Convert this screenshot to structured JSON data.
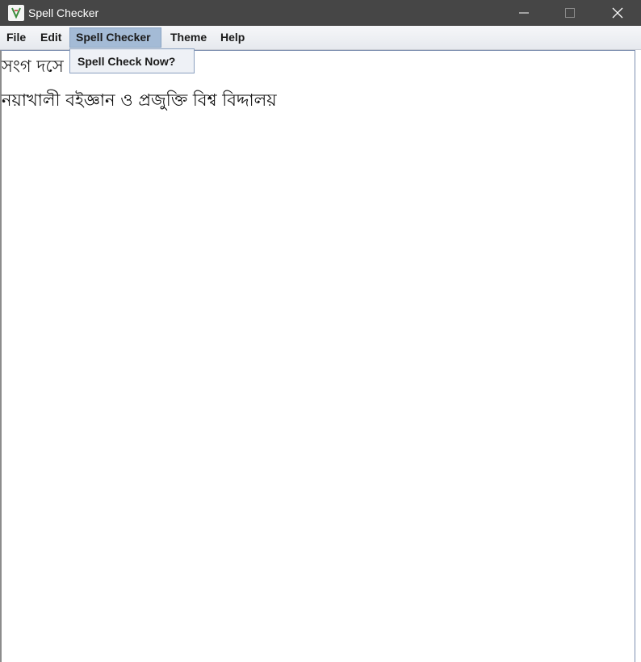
{
  "window": {
    "title": "Spell Checker",
    "icon": "spell-checker-app-icon",
    "controls": [
      "minimize-icon",
      "maximize-icon",
      "close-icon"
    ]
  },
  "menubar": {
    "items": [
      {
        "label": "File"
      },
      {
        "label": "Edit"
      },
      {
        "label": "Spell Checker",
        "active": true
      },
      {
        "label": "Theme"
      },
      {
        "label": "Help"
      }
    ]
  },
  "dropdown": {
    "items": [
      {
        "label": "Spell Check Now?"
      }
    ]
  },
  "editor": {
    "lines": [
      "সংগ দসে",
      "নয়াখালী বইজ্ঞান ও প্রজুক্তি বিশ্ব বিদ্দালয়"
    ]
  },
  "colors": {
    "titlebar": "#464646",
    "menu_active": "#a4bbd6",
    "dropdown_bg": "#eef1f6"
  }
}
